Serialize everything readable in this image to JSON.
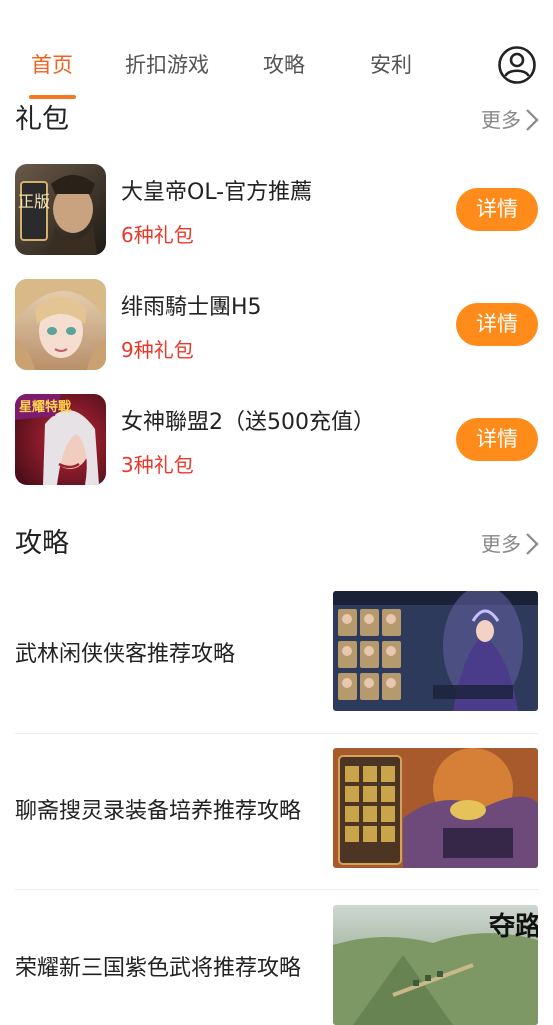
{
  "tabs": [
    {
      "label": "首页",
      "active": true
    },
    {
      "label": "折扣游戏",
      "active": false
    },
    {
      "label": "攻略",
      "active": false
    },
    {
      "label": "安利",
      "active": false
    }
  ],
  "icons": {
    "user": "user-circle-icon",
    "more": "chevron-right-icon"
  },
  "colors": {
    "accent": "#f37a1f",
    "button": "#ff8c1a",
    "count": "#e8392b"
  },
  "gifts": {
    "title": "礼包",
    "more_label": "更多",
    "items": [
      {
        "name": "大皇帝OL-官方推薦",
        "count": "6种礼包",
        "button": "详情",
        "icon_text": "正版"
      },
      {
        "name": "绯雨騎士團H5",
        "count": "9种礼包",
        "button": "详情"
      },
      {
        "name": "女神聯盟2（送500充值）",
        "count": "3种礼包",
        "button": "详情",
        "icon_text": "星耀特戰"
      }
    ]
  },
  "guides": {
    "title": "攻略",
    "more_label": "更多",
    "items": [
      {
        "title": "武林闲侠侠客推荐攻略"
      },
      {
        "title": "聊斋搜灵录装备培养推荐攻略"
      },
      {
        "title": "荣耀新三国紫色武将推荐攻略",
        "thumb_text": "夺路"
      }
    ]
  }
}
